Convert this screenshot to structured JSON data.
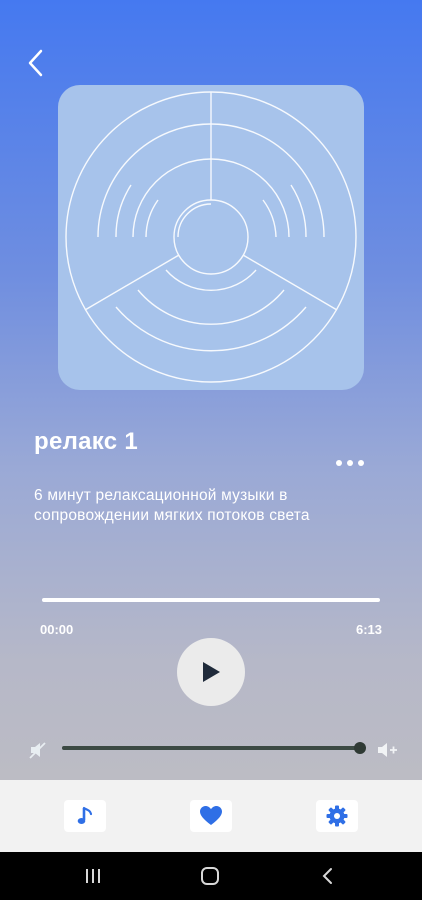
{
  "track": {
    "title": "релакс 1",
    "description": "6 минут релаксационной музыки в сопровождении мягких потоков света"
  },
  "player": {
    "current_time": "00:00",
    "duration": "6:13",
    "progress": 0.0,
    "volume": 1.0
  },
  "bottom_nav": {
    "items": [
      {
        "icon": "music-note-icon"
      },
      {
        "icon": "heart-icon"
      },
      {
        "icon": "gear-icon"
      }
    ]
  },
  "colors": {
    "accent": "#2f6fe6",
    "gradient_top": "#4579f0",
    "gradient_bottom": "#bcbcc4",
    "artwork_bg": "#a7c3eb"
  }
}
